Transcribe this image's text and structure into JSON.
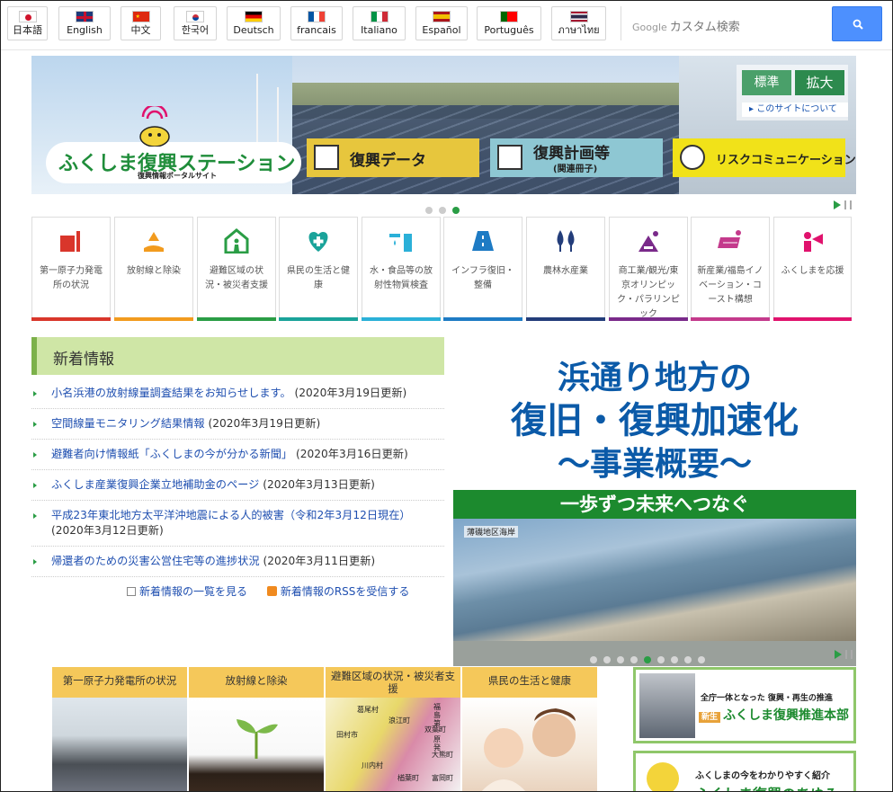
{
  "languages": [
    {
      "label": "日本語",
      "flag": "jp"
    },
    {
      "label": "English",
      "flag": "uk"
    },
    {
      "label": "中文",
      "flag": "cn"
    },
    {
      "label": "한국어",
      "flag": "kr"
    },
    {
      "label": "Deutsch",
      "flag": "de"
    },
    {
      "label": "francais",
      "flag": "fr"
    },
    {
      "label": "Italiano",
      "flag": "it"
    },
    {
      "label": "Español",
      "flag": "es"
    },
    {
      "label": "Português",
      "flag": "pt"
    },
    {
      "label": "ภาษาไทย",
      "flag": "th"
    }
  ],
  "search": {
    "brand": "Google",
    "placeholder": "カスタム検索",
    "button_icon": "search-icon"
  },
  "hero": {
    "logo_title": "ふくしま復興ステーション",
    "logo_subtitle": "復興情報ポータルサイト",
    "buttons": [
      {
        "label": "復興データ",
        "icon": "chart-icon"
      },
      {
        "label": "復興計画等",
        "sub": "(関連冊子)",
        "icon": "book-icon"
      },
      {
        "label": "リスクコミュニケーション",
        "icon": "handshake-icon"
      }
    ],
    "font_size": {
      "normal": "標準",
      "large": "拡大"
    },
    "about": "このサイトについて",
    "slide_index": 3,
    "slide_count": 3
  },
  "categories": [
    {
      "label": "第一原子力発電所の状況",
      "color": "#d9362b",
      "icon": "power-plant-icon"
    },
    {
      "label": "放射線と除染",
      "color": "#f29b1e",
      "icon": "radiation-hand-icon"
    },
    {
      "label": "避難区域の状況・被災者支援",
      "color": "#2a9d45",
      "icon": "shelter-icon"
    },
    {
      "label": "県民の生活と健康",
      "color": "#1aa39a",
      "icon": "health-icon"
    },
    {
      "label": "水・食品等の放射性物質検査",
      "color": "#2bb0d8",
      "icon": "water-milk-icon"
    },
    {
      "label": "インフラ復旧・整備",
      "color": "#1e7bc4",
      "icon": "road-icon"
    },
    {
      "label": "農林水産業",
      "color": "#233d7a",
      "icon": "tree-icon"
    },
    {
      "label": "商工業/観光/東京オリンピック・パラリンピック",
      "color": "#7a2a8a",
      "icon": "factory-icon"
    },
    {
      "label": "新産業/福島イノベーション・コースト構想",
      "color": "#c43a8c",
      "icon": "solar-panel-icon"
    },
    {
      "label": "ふくしまを応援",
      "color": "#e0126d",
      "icon": "megaphone-icon"
    }
  ],
  "news": {
    "heading": "新着情報",
    "items": [
      {
        "title": "小名浜港の放射線量調査結果をお知らせします。",
        "date": "(2020年3月19日更新)"
      },
      {
        "title": "空間線量モニタリング結果情報",
        "date": "(2020年3月19日更新)"
      },
      {
        "title": "避難者向け情報紙「ふくしまの今が分かる新聞」",
        "date": "(2020年3月16日更新)"
      },
      {
        "title": "ふくしま産業復興企業立地補助金のページ",
        "date": "(2020年3月13日更新)"
      },
      {
        "title": "平成23年東北地方太平洋沖地震による人的被害（令和2年3月12日現在）",
        "date": "(2020年3月12日更新)"
      },
      {
        "title": "帰還者のための災害公営住宅等の進捗状況",
        "date": "(2020年3月11日更新)"
      }
    ],
    "more_label": "新着情報の一覧を見る",
    "rss_label": "新着情報のRSSを受信する"
  },
  "promo": {
    "line1": "浜通り地方の",
    "line2": "復旧・復興加速化",
    "line3": "〜事業概要〜",
    "band": "一歩ずつ未来へつなぐ",
    "caption": "薄磯地区海岸",
    "slide_index": 5,
    "slide_count": 9
  },
  "cards": [
    {
      "title": "第一原子力発電所の状況"
    },
    {
      "title": "放射線と除染"
    },
    {
      "title": "避難区域の状況・被災者支援",
      "map_labels": [
        "葛尾村",
        "浪江町",
        "田村市",
        "双葉町",
        "川内村",
        "大熊町",
        "楢葉町",
        "富岡町",
        "福島第一原発"
      ]
    },
    {
      "title": "県民の生活と健康"
    }
  ],
  "side": [
    {
      "line1": "全庁一体となった 復興・再生の推進",
      "badge": "新生",
      "line2": "ふくしま復興推進本部"
    },
    {
      "line1": "ふくしまの今をわかりやすく紹介",
      "line2": "ふくしま復興のあゆみ"
    }
  ]
}
